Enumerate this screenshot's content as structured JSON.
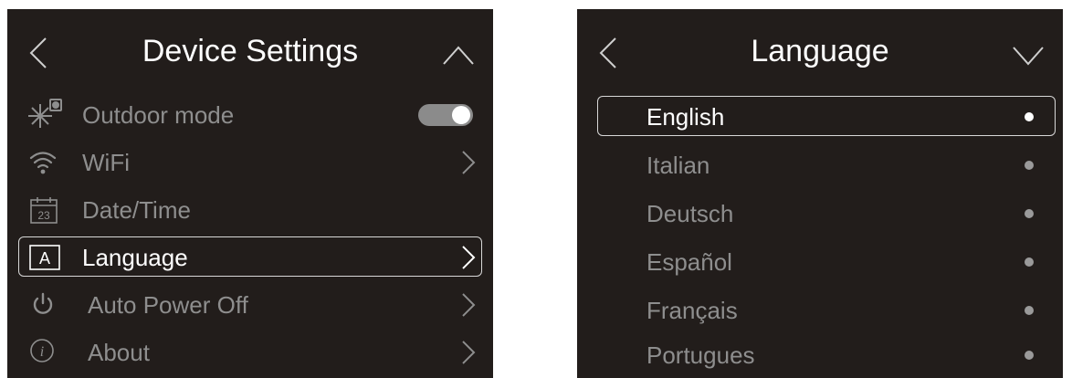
{
  "device_settings": {
    "title": "Device Settings",
    "back_icon": "chevron-left-icon",
    "collapse_icon": "chevron-up-icon",
    "items": [
      {
        "label": "Outdoor mode",
        "icon": "sun-shield-icon",
        "control": "toggle",
        "toggle_on": true
      },
      {
        "label": "WiFi",
        "icon": "wifi-icon",
        "control": "chevron"
      },
      {
        "label": "Date/Time",
        "icon": "calendar-icon",
        "icon_text": "23",
        "control": "none"
      },
      {
        "label": "Language",
        "icon": "language-icon",
        "icon_text": "A",
        "control": "chevron",
        "selected": true
      },
      {
        "label": "Auto Power Off",
        "icon": "power-icon",
        "control": "chevron"
      },
      {
        "label": "About",
        "icon": "info-icon",
        "icon_text": "i",
        "control": "chevron"
      }
    ]
  },
  "language": {
    "title": "Language",
    "back_icon": "chevron-left-icon",
    "expand_icon": "chevron-down-icon",
    "options": [
      {
        "label": "English",
        "selected": true
      },
      {
        "label": "Italian",
        "selected": false
      },
      {
        "label": "Deutsch",
        "selected": false
      },
      {
        "label": "Español",
        "selected": false
      },
      {
        "label": "Français",
        "selected": false
      },
      {
        "label": "Portugues",
        "selected": false
      }
    ]
  },
  "colors": {
    "panel_bg": "#221d1b",
    "selected_text": "#ffffff",
    "unselected_text": "#8e8e8e",
    "toggle_on": "#8b8b8b"
  }
}
